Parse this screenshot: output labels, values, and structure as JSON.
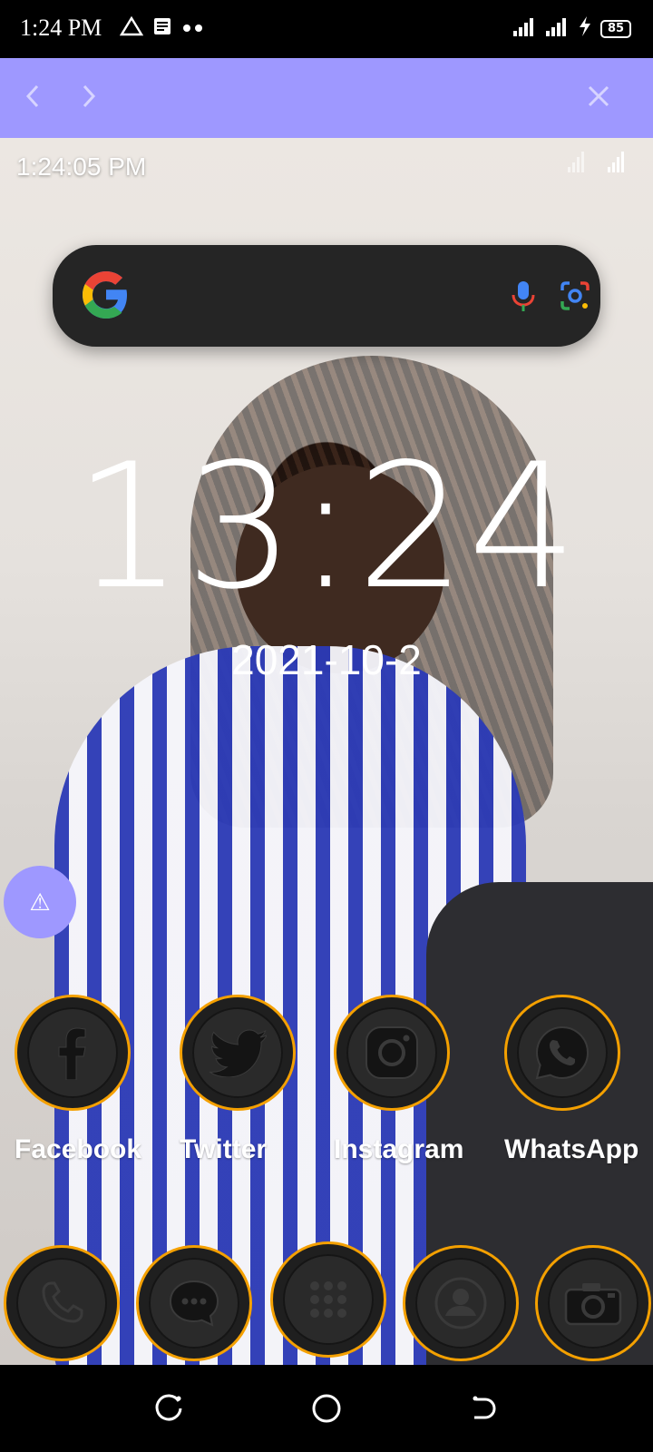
{
  "status_bar": {
    "time": "1:24 PM",
    "battery": "85",
    "icons": [
      "alert-triangle-icon",
      "notes-icon",
      "more-dots-icon",
      "signal-icon",
      "signal-icon",
      "charging-icon"
    ]
  },
  "browser_nav": {
    "back_icon": "chevron-left-icon",
    "forward_icon": "chevron-right-icon",
    "close_icon": "close-icon",
    "accent": "#9e98ff"
  },
  "widget": {
    "time": "1:24:05 PM"
  },
  "search": {
    "provider_icon": "google-icon",
    "mic_icon": "mic-icon",
    "lens_icon": "lens-icon"
  },
  "clock": {
    "time": "13:24",
    "date": "2021-10-2"
  },
  "fab": {
    "icon": "warning-icon",
    "glyph": "⚠"
  },
  "apps": [
    {
      "label": "Facebook",
      "icon": "facebook-icon"
    },
    {
      "label": "Twitter",
      "icon": "twitter-icon"
    },
    {
      "label": "Instagram",
      "icon": "instagram-icon"
    },
    {
      "label": "WhatsApp",
      "icon": "whatsapp-icon"
    }
  ],
  "dock": [
    {
      "icon": "phone-icon"
    },
    {
      "icon": "messages-icon"
    },
    {
      "icon": "app-drawer-icon"
    },
    {
      "icon": "contacts-icon"
    },
    {
      "icon": "camera-icon"
    }
  ],
  "system_nav": {
    "recents_icon": "recents-icon",
    "home_icon": "home-icon",
    "back_icon": "back-icon"
  },
  "colors": {
    "ring": "#f4a000",
    "icon_bg": "#1f1f1f"
  }
}
